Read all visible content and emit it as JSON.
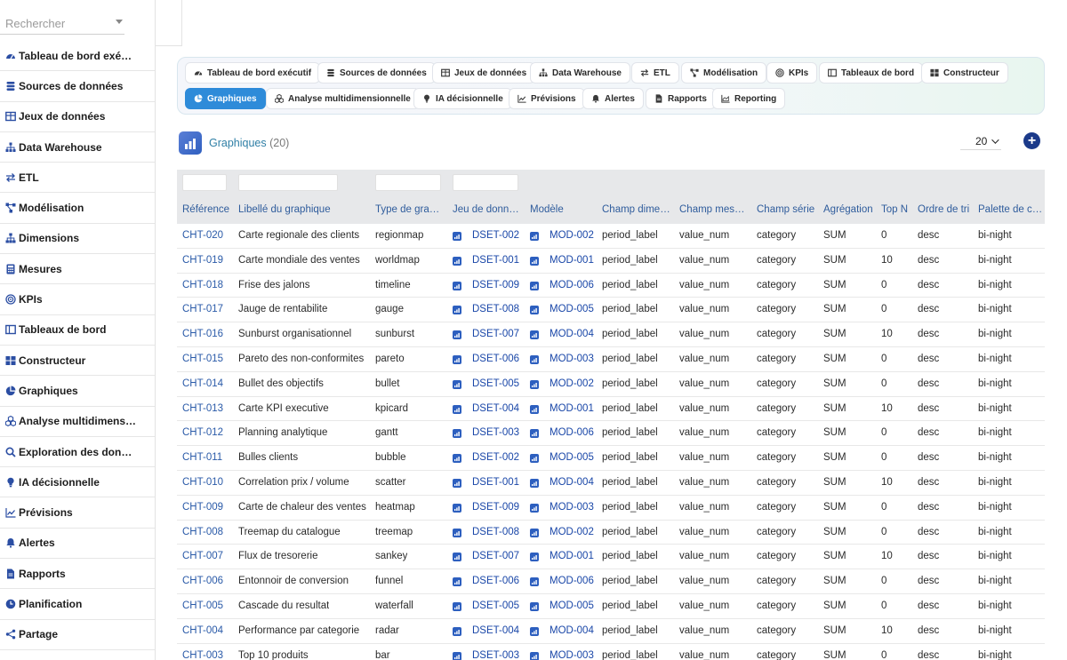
{
  "search": {
    "placeholder": "Rechercher"
  },
  "sidebar": {
    "items": [
      {
        "label": "Tableau de bord exé…",
        "icon": "gauge-icon"
      },
      {
        "label": "Sources de données",
        "icon": "database-icon"
      },
      {
        "label": "Jeux de données",
        "icon": "table-icon"
      },
      {
        "label": "Data Warehouse",
        "icon": "sitemap-icon"
      },
      {
        "label": "ETL",
        "icon": "exchange-icon"
      },
      {
        "label": "Modélisation",
        "icon": "nodes-icon"
      },
      {
        "label": "Dimensions",
        "icon": "hierarchy-icon"
      },
      {
        "label": "Mesures",
        "icon": "calculator-icon"
      },
      {
        "label": "KPIs",
        "icon": "bullseye-icon"
      },
      {
        "label": "Tableaux de bord",
        "icon": "layout-icon"
      },
      {
        "label": "Constructeur",
        "icon": "grid-icon"
      },
      {
        "label": "Graphiques",
        "icon": "pie-chart-icon"
      },
      {
        "label": "Analyse multidimens…",
        "icon": "cubes-icon"
      },
      {
        "label": "Exploration des don…",
        "icon": "search-icon"
      },
      {
        "label": "IA décisionnelle",
        "icon": "lightbulb-icon"
      },
      {
        "label": "Prévisions",
        "icon": "line-chart-icon"
      },
      {
        "label": "Alertes",
        "icon": "bell-icon"
      },
      {
        "label": "Rapports",
        "icon": "file-icon"
      },
      {
        "label": "Planification",
        "icon": "clock-icon"
      },
      {
        "label": "Partage",
        "icon": "share-icon"
      }
    ]
  },
  "tabs": {
    "row1": [
      {
        "label": "Tableau de bord exécutif",
        "icon": "gauge-icon"
      },
      {
        "label": "Sources de données",
        "icon": "database-icon"
      },
      {
        "label": "Jeux de données",
        "icon": "table-icon"
      },
      {
        "label": "Data Warehouse",
        "icon": "sitemap-icon"
      },
      {
        "label": "ETL",
        "icon": "exchange-icon"
      },
      {
        "label": "Modélisation",
        "icon": "nodes-icon"
      },
      {
        "label": "KPIs",
        "icon": "bullseye-icon"
      },
      {
        "label": "Tableaux de bord",
        "icon": "layout-icon"
      },
      {
        "label": "Constructeur",
        "icon": "grid-icon"
      }
    ],
    "row2": [
      {
        "label": "Graphiques",
        "icon": "pie-chart-icon",
        "active": true
      },
      {
        "label": "Analyse multidimensionnelle",
        "icon": "cubes-icon"
      },
      {
        "label": "IA décisionnelle",
        "icon": "lightbulb-icon"
      },
      {
        "label": "Prévisions",
        "icon": "line-chart-icon"
      },
      {
        "label": "Alertes",
        "icon": "bell-icon"
      },
      {
        "label": "Rapports",
        "icon": "file-icon"
      },
      {
        "label": "Reporting",
        "icon": "area-chart-icon"
      }
    ]
  },
  "header": {
    "title": "Graphiques",
    "count": "(20)",
    "page_size": "20",
    "add_label": "+"
  },
  "colors": {
    "accent": "#2e8bd9",
    "link": "#1a47a8",
    "title": "#2f7fa6",
    "add": "#1b3a8a"
  },
  "table": {
    "columns": [
      "Référence",
      "Libellé du graphique",
      "Type de gra…",
      "Jeu de donn…",
      "Modèle",
      "Champ dime…",
      "Champ mes…",
      "Champ série",
      "Agrégation",
      "Top N",
      "Ordre de tri",
      "Palette de c…"
    ],
    "rows": [
      [
        "CHT-020",
        "Carte regionale des clients",
        "regionmap",
        "DSET-002",
        "MOD-002",
        "period_label",
        "value_num",
        "category",
        "SUM",
        "0",
        "desc",
        "bi-night"
      ],
      [
        "CHT-019",
        "Carte mondiale des ventes",
        "worldmap",
        "DSET-001",
        "MOD-001",
        "period_label",
        "value_num",
        "category",
        "SUM",
        "10",
        "desc",
        "bi-night"
      ],
      [
        "CHT-018",
        "Frise des jalons",
        "timeline",
        "DSET-009",
        "MOD-006",
        "period_label",
        "value_num",
        "category",
        "SUM",
        "0",
        "desc",
        "bi-night"
      ],
      [
        "CHT-017",
        "Jauge de rentabilite",
        "gauge",
        "DSET-008",
        "MOD-005",
        "period_label",
        "value_num",
        "category",
        "SUM",
        "0",
        "desc",
        "bi-night"
      ],
      [
        "CHT-016",
        "Sunburst organisationnel",
        "sunburst",
        "DSET-007",
        "MOD-004",
        "period_label",
        "value_num",
        "category",
        "SUM",
        "10",
        "desc",
        "bi-night"
      ],
      [
        "CHT-015",
        "Pareto des non-conformites",
        "pareto",
        "DSET-006",
        "MOD-003",
        "period_label",
        "value_num",
        "category",
        "SUM",
        "0",
        "desc",
        "bi-night"
      ],
      [
        "CHT-014",
        "Bullet des objectifs",
        "bullet",
        "DSET-005",
        "MOD-002",
        "period_label",
        "value_num",
        "category",
        "SUM",
        "0",
        "desc",
        "bi-night"
      ],
      [
        "CHT-013",
        "Carte KPI executive",
        "kpicard",
        "DSET-004",
        "MOD-001",
        "period_label",
        "value_num",
        "category",
        "SUM",
        "10",
        "desc",
        "bi-night"
      ],
      [
        "CHT-012",
        "Planning analytique",
        "gantt",
        "DSET-003",
        "MOD-006",
        "period_label",
        "value_num",
        "category",
        "SUM",
        "0",
        "desc",
        "bi-night"
      ],
      [
        "CHT-011",
        "Bulles clients",
        "bubble",
        "DSET-002",
        "MOD-005",
        "period_label",
        "value_num",
        "category",
        "SUM",
        "0",
        "desc",
        "bi-night"
      ],
      [
        "CHT-010",
        "Correlation prix / volume",
        "scatter",
        "DSET-001",
        "MOD-004",
        "period_label",
        "value_num",
        "category",
        "SUM",
        "10",
        "desc",
        "bi-night"
      ],
      [
        "CHT-009",
        "Carte de chaleur des ventes",
        "heatmap",
        "DSET-009",
        "MOD-003",
        "period_label",
        "value_num",
        "category",
        "SUM",
        "0",
        "desc",
        "bi-night"
      ],
      [
        "CHT-008",
        "Treemap du catalogue",
        "treemap",
        "DSET-008",
        "MOD-002",
        "period_label",
        "value_num",
        "category",
        "SUM",
        "0",
        "desc",
        "bi-night"
      ],
      [
        "CHT-007",
        "Flux de tresorerie",
        "sankey",
        "DSET-007",
        "MOD-001",
        "period_label",
        "value_num",
        "category",
        "SUM",
        "10",
        "desc",
        "bi-night"
      ],
      [
        "CHT-006",
        "Entonnoir de conversion",
        "funnel",
        "DSET-006",
        "MOD-006",
        "period_label",
        "value_num",
        "category",
        "SUM",
        "0",
        "desc",
        "bi-night"
      ],
      [
        "CHT-005",
        "Cascade du resultat",
        "waterfall",
        "DSET-005",
        "MOD-005",
        "period_label",
        "value_num",
        "category",
        "SUM",
        "0",
        "desc",
        "bi-night"
      ],
      [
        "CHT-004",
        "Performance par categorie",
        "radar",
        "DSET-004",
        "MOD-004",
        "period_label",
        "value_num",
        "category",
        "SUM",
        "10",
        "desc",
        "bi-night"
      ],
      [
        "CHT-003",
        "Top 10 produits",
        "bar",
        "DSET-003",
        "MOD-003",
        "period_label",
        "value_num",
        "category",
        "SUM",
        "0",
        "desc",
        "bi-night"
      ]
    ]
  }
}
